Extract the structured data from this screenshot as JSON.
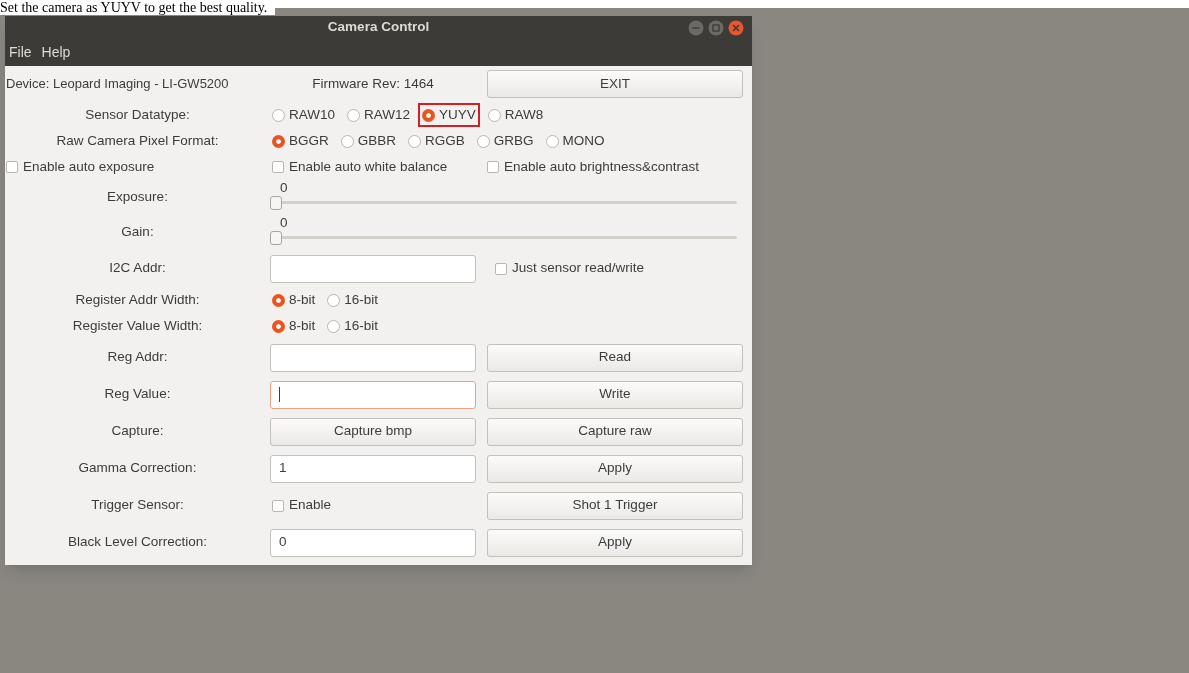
{
  "caption": "Set the camera as YUYV to get the best quality.",
  "window": {
    "title": "Camera Control"
  },
  "menu": [
    "File",
    "Help"
  ],
  "header": {
    "device": "Device: Leopard Imaging - LI-GW5200",
    "firmware": "Firmware Rev: 1464",
    "exit_button": "EXIT"
  },
  "rows": [
    {
      "kind": "radio",
      "label": "Sensor Datatype:",
      "options": [
        {
          "label": "RAW10",
          "selected": false,
          "highlighted": false
        },
        {
          "label": "RAW12",
          "selected": false,
          "highlighted": false
        },
        {
          "label": "YUYV",
          "selected": true,
          "highlighted": true
        },
        {
          "label": "RAW8",
          "selected": false,
          "highlighted": false
        }
      ]
    },
    {
      "kind": "radio",
      "label": "Raw Camera Pixel Format:",
      "options": [
        {
          "label": "BGGR",
          "selected": true,
          "highlighted": false
        },
        {
          "label": "GBBR",
          "selected": false,
          "highlighted": false
        },
        {
          "label": "RGGB",
          "selected": false,
          "highlighted": false
        },
        {
          "label": "GRBG",
          "selected": false,
          "highlighted": false
        },
        {
          "label": "MONO",
          "selected": false,
          "highlighted": false
        }
      ]
    },
    {
      "kind": "checks",
      "checks": [
        {
          "label": "Enable auto exposure",
          "checked": false
        },
        {
          "label": "Enable auto white balance",
          "checked": false
        },
        {
          "label": "Enable auto brightness&contrast",
          "checked": false
        }
      ]
    },
    {
      "kind": "slider",
      "label": "Exposure:",
      "reading": "0",
      "level": 0
    },
    {
      "kind": "slider",
      "label": "Gain:",
      "reading": "0",
      "level": 0
    },
    {
      "kind": "field_check",
      "label": "I2C Addr:",
      "field": {
        "focused": false
      },
      "check": {
        "label": "Just sensor read/write",
        "checked": false
      }
    },
    {
      "kind": "radio",
      "label": "Register Addr Width:",
      "options": [
        {
          "label": "8-bit",
          "selected": true,
          "highlighted": false
        },
        {
          "label": "16-bit",
          "selected": false,
          "highlighted": false
        }
      ]
    },
    {
      "kind": "radio",
      "label": "Register Value Width:",
      "options": [
        {
          "label": "8-bit",
          "selected": true,
          "highlighted": false
        },
        {
          "label": "16-bit",
          "selected": false,
          "highlighted": false
        }
      ]
    },
    {
      "kind": "field_button",
      "label": "Reg Addr:",
      "field": {
        "focused": false
      },
      "button": "Read"
    },
    {
      "kind": "field_button",
      "label": "Reg Value:",
      "field": {
        "focused": true
      },
      "button": "Write"
    },
    {
      "kind": "buttons",
      "label": "Capture:",
      "buttons": [
        "Capture bmp",
        "Capture raw"
      ]
    },
    {
      "kind": "field_button",
      "label": "Gamma Correction:",
      "field": {
        "value": "1",
        "focused": false
      },
      "button": "Apply"
    },
    {
      "kind": "check_button",
      "label": "Trigger Sensor:",
      "check": {
        "label": "Enable",
        "checked": false
      },
      "button": "Shot 1 Trigger"
    },
    {
      "kind": "field_button",
      "label": "Black Level Correction:",
      "field": {
        "value": "0",
        "focused": false
      },
      "button": "Apply"
    }
  ]
}
